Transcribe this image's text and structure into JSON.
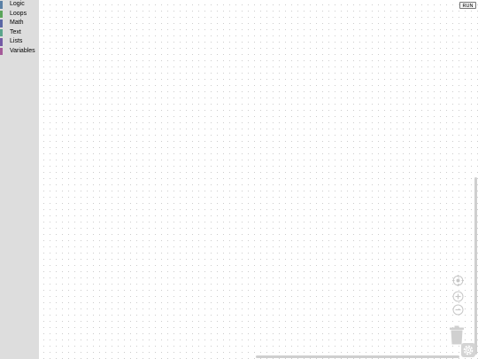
{
  "toolbox": {
    "categories": [
      {
        "label": "Logic",
        "color": "#5b80a5"
      },
      {
        "label": "Loops",
        "color": "#5ba55b"
      },
      {
        "label": "Math",
        "color": "#5b67a5"
      },
      {
        "label": "Text",
        "color": "#5ba58c"
      },
      {
        "label": "Lists",
        "color": "#745ba5"
      },
      {
        "label": "Variables",
        "color": "#a55b99"
      }
    ]
  },
  "workspace": {
    "run_label": "RUN",
    "icons": {
      "reset_zoom": "target-icon",
      "zoom_in": "plus-circle-icon",
      "zoom_out": "minus-circle-icon",
      "trash": "trash-icon",
      "settings": "gear-icon"
    }
  }
}
